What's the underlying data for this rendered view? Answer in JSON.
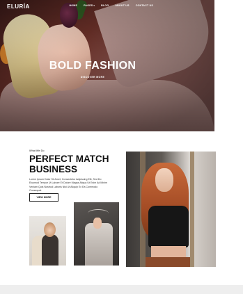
{
  "header": {
    "logo": "ELURÍA",
    "nav": [
      {
        "label": "HOME"
      },
      {
        "label": "PAGES",
        "has_dropdown": true
      },
      {
        "label": "BLOG"
      },
      {
        "label": "ABOUT US"
      },
      {
        "label": "CONTACT US"
      }
    ]
  },
  "hero": {
    "title": "BOLD FASHION",
    "cta": "DISCOVER MORE"
  },
  "about": {
    "kicker": "What We Do",
    "title": "PERFECT MATCH BUSINESS",
    "description": "Lorem Ipsum Dolor Sit Amet, Consectetur Adipiscing Elit, Sed Do Eiusmod Tempor Ut Labore Et Dolore Magna Aliqua Ut Enim Ad Minim Veniam Quis Nostrud Laboris Nisi Ut Aliquip Ex Ea Commodo Consequat",
    "button": "VIEW MORE"
  },
  "colors": {
    "text": "#111111",
    "hero_overlay": "#6a3028",
    "footer": "#eeeeee"
  }
}
